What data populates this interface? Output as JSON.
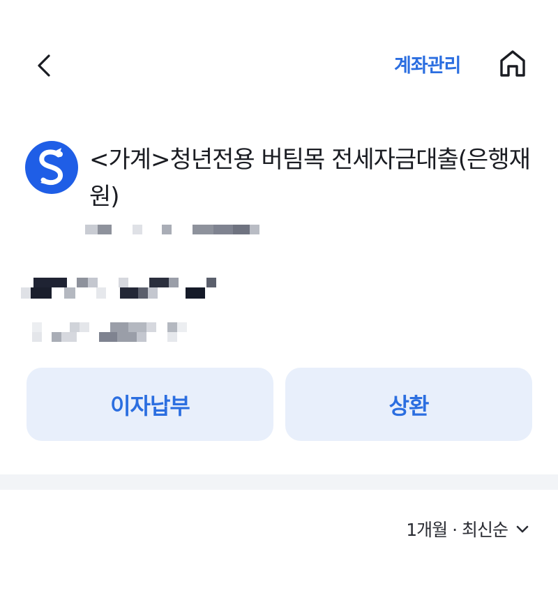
{
  "header": {
    "back_icon": "chevron-left-icon",
    "manage_label": "계좌관리",
    "home_icon": "home-icon"
  },
  "account": {
    "bank_logo": "shinhan-bank-logo",
    "title": "<가계>청년전용 버팀목 전세자금대출(은행재원)"
  },
  "actions": {
    "interest_label": "이자납부",
    "repay_label": "상환"
  },
  "filter": {
    "label": "1개월 · 최신순",
    "icon": "chevron-down-icon"
  },
  "colors": {
    "accent": "#2b6ee0",
    "button_bg": "#e8effb",
    "logo_bg": "#1f5ee6",
    "divider": "#f2f4f7"
  }
}
